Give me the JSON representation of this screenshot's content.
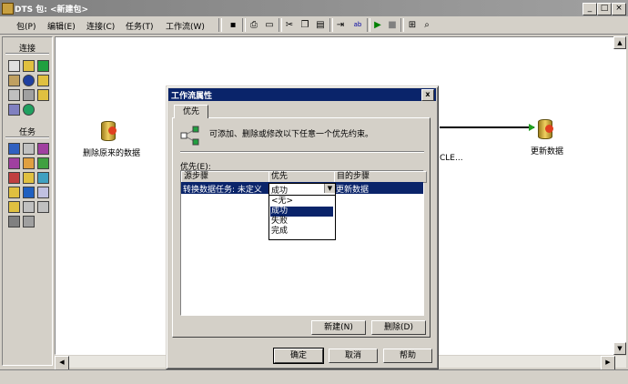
{
  "window": {
    "title": "DTS 包: <新建包>"
  },
  "menubar": {
    "items": [
      "包(P)",
      "编辑(E)",
      "连接(C)",
      "任务(T)",
      "工作流(W)"
    ]
  },
  "toolbar": {
    "icons": [
      "save-icon",
      "print-icon",
      "properties-icon",
      "cut-icon",
      "copy-icon",
      "paste-icon",
      "connect-icon",
      "transform-icon",
      "run-icon",
      "stop-icon",
      "layout-icon",
      "zoom-icon"
    ]
  },
  "palette": {
    "connections_label": "连接",
    "tasks_label": "任务"
  },
  "canvas": {
    "nodes": [
      {
        "label": "删除原来的数据"
      },
      {
        "label": "更新数据"
      }
    ],
    "partial_label": "CLE..."
  },
  "dialog": {
    "title": "工作流属性",
    "close_label": "x",
    "tab_label": "优先",
    "info_text": "可添加、删除或修改以下任意一个优先约束。",
    "precedence_label": "优先(E):",
    "columns": [
      "源步骤",
      "优先",
      "目的步骤"
    ],
    "row": {
      "source": "转换数据任务: 未定义",
      "precedence": "成功",
      "destination": "更新数据"
    },
    "dropdown_options": [
      "<无>",
      "成功",
      "失败",
      "完成"
    ],
    "selected_option_index": 1,
    "new_button": "新建(N)",
    "delete_button": "删除(D)",
    "ok_button": "确定",
    "cancel_button": "取消",
    "help_button": "帮助"
  },
  "colors": {
    "selection": "#0a246a",
    "chrome": "#d4d0c8",
    "canvas": "#ffffff"
  }
}
